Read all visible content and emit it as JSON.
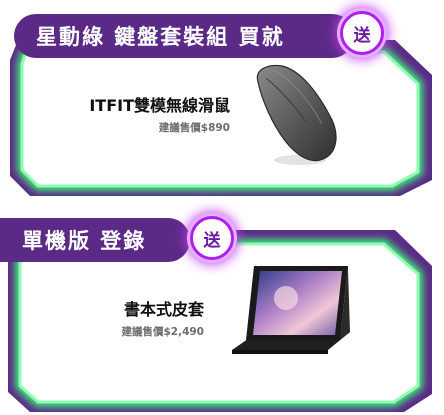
{
  "colors": {
    "frame_purple": "#5b2a86",
    "frame_glow_green": "#3cff7a",
    "badge_ring": "#b21ef0",
    "badge_text": "#6a1aa0"
  },
  "offers": [
    {
      "header_title": "星動綠 鍵盤套裝組 買就",
      "badge_label": "送",
      "product_name": "ITFIT雙模無線滑鼠",
      "product_price": "建議售價$890",
      "product_icon": "wireless-mouse-icon"
    },
    {
      "header_title": "單機版 登錄",
      "badge_label": "送",
      "product_name": "書本式皮套",
      "product_price": "建議售價$2,490",
      "product_icon": "tablet-book-cover-icon"
    }
  ]
}
